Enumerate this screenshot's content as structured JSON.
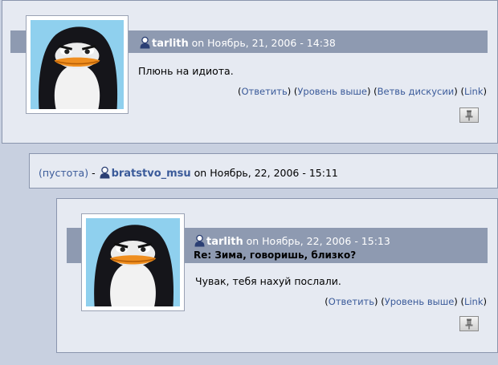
{
  "comment1": {
    "author": "tarlith",
    "date_text": "on Ноябрь, 21, 2006 - 14:38",
    "body": "Плюнь на идиота.",
    "links": [
      "Ответить",
      "Уровень выше",
      "Ветвь дискусии",
      "Link"
    ]
  },
  "reply_header": {
    "empty_label": "(пустота)",
    "separator": "-",
    "author": "bratstvo_msu",
    "date_text": "on Ноябрь, 22, 2006 - 15:11"
  },
  "comment2": {
    "author": "tarlith",
    "date_text": "on Ноябрь, 22, 2006 - 15:13",
    "title": "Re: Зима, говоришь, близко?",
    "body": "Чувак, тебя нахуй послали.",
    "links": [
      "Ответить",
      "Уровень выше",
      "Link"
    ]
  },
  "icons": {
    "user": "user-silhouette-icon",
    "pin": "pushpin-icon"
  },
  "colors": {
    "page_bg": "#c8d0e0",
    "box_bg": "#e6eaf2",
    "header_bar": "#8e9ab1",
    "link": "#3b5b9a",
    "avatar_bg": "#8fd0ee"
  }
}
